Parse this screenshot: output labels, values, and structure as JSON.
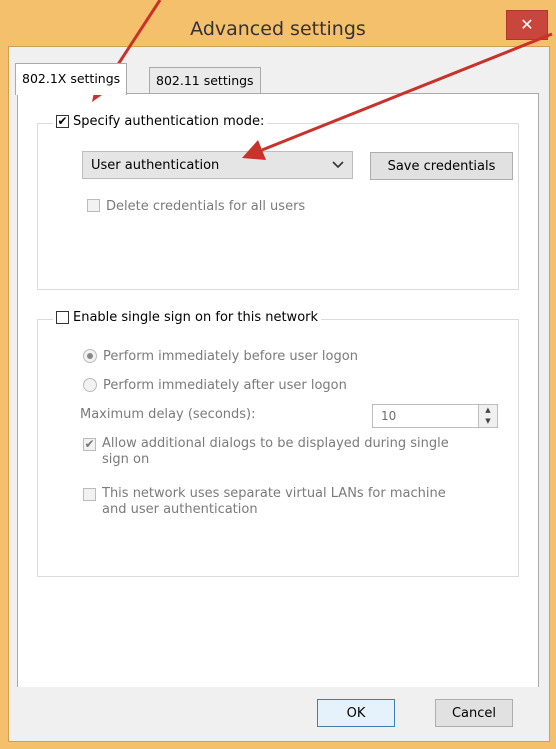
{
  "window": {
    "title": "Advanced settings",
    "close_glyph": "✕"
  },
  "tabs": [
    {
      "label": "802.1X settings",
      "active": true
    },
    {
      "label": "802.11 settings",
      "active": false
    }
  ],
  "auth_group": {
    "checkbox_label": "Specify authentication mode:",
    "checked": true,
    "mode_select_value": "User authentication",
    "save_credentials_label": "Save credentials",
    "delete_credentials_label": "Delete credentials for all users"
  },
  "sso_group": {
    "checkbox_label": "Enable single sign on for this network",
    "checked": false,
    "radio_before": "Perform immediately before user logon",
    "radio_after": "Perform immediately after user logon",
    "max_delay_label": "Maximum delay (seconds):",
    "max_delay_value": "10",
    "allow_dialogs_label_line1": "Allow additional dialogs to be displayed during single",
    "allow_dialogs_label_line2": "sign on",
    "vlan_label_line1": "This network uses separate virtual LANs for machine",
    "vlan_label_line2": "and user authentication"
  },
  "buttons": {
    "ok": "OK",
    "cancel": "Cancel"
  },
  "annotation": {
    "arrow_color": "#c8322a"
  },
  "icons": {
    "close": "close-icon",
    "dropdown": "chevron-down-icon",
    "spin_up": "spin-up-icon",
    "spin_down": "spin-down-icon",
    "check": "checkmark-icon"
  }
}
